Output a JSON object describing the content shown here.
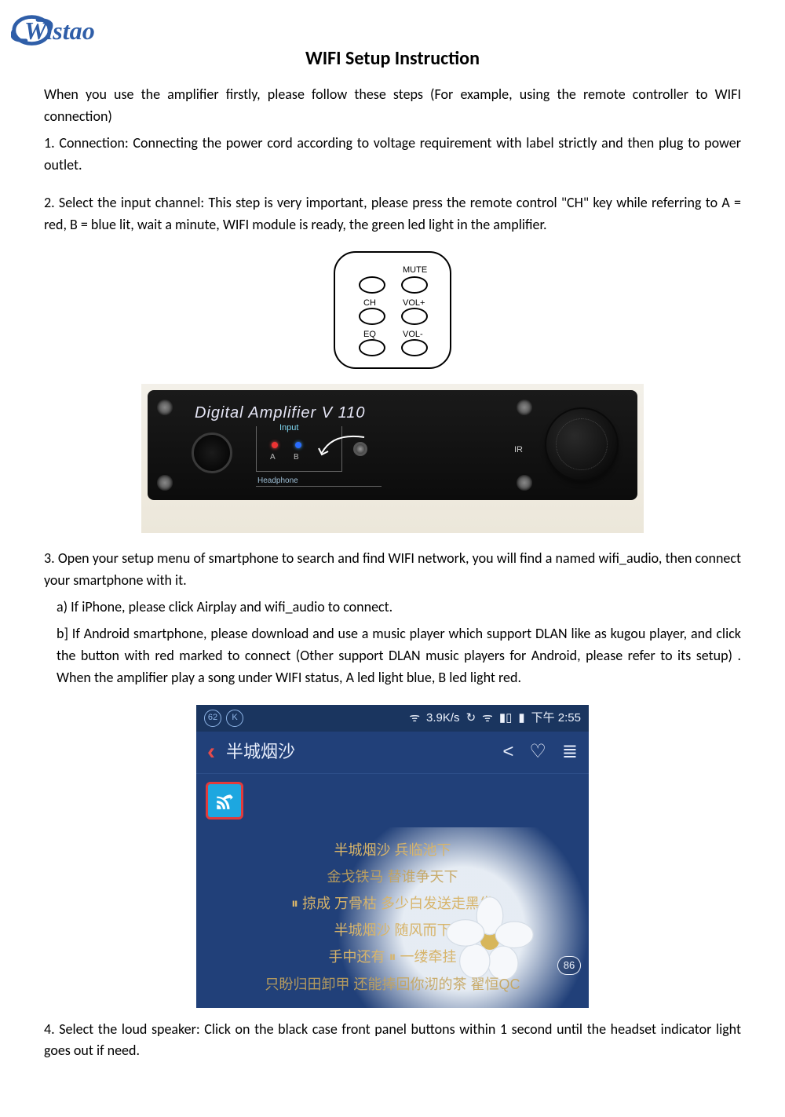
{
  "logo_text": "Wistao",
  "title": "WIFI Setup Instruction",
  "intro": "When you use the amplifier firstly, please follow these steps (For example, using the remote controller to WIFI connection)",
  "steps": {
    "s1": "1.    Connection: Connecting the power cord according to voltage requirement with label strictly and then plug to power outlet.",
    "s2": "2.    Select the input channel: This step is very important, please press the remote control \"CH\" key while referring to A = red, B = blue lit, wait a minute, WIFI module is ready, the green led light in the amplifier.",
    "s3": "3.    Open your setup menu of smartphone to search and find WIFI network, you will find a named wifi_audio, then connect your smartphone with it.",
    "s3a": "a) If iPhone, please click Airplay and wifi_audio to connect.",
    "s3b": "b] If Android smartphone, please download and use a music player which support DLAN like as kugou player, and click the button with red marked to connect (Other support DLAN music players for Android, please refer to its setup) . When the amplifier play a song under WIFI status, A led light blue, B led light red.",
    "s4": "4.    Select the loud speaker: Click on the black case front panel buttons within 1 second until the headset indicator light goes out if need."
  },
  "remote": {
    "mute": "MUTE",
    "ch": "CH",
    "volp": "VOL+",
    "eq": "EQ",
    "volm": "VOL-"
  },
  "amp": {
    "title": "Digital Amplifier V 110",
    "input": "Input",
    "a": "A",
    "b": "B",
    "headphone": "Headphone",
    "ir": "IR"
  },
  "phone": {
    "status": {
      "num": "62",
      "k": "K",
      "rate": "3.9K/s",
      "time": "下午 2:55"
    },
    "header": {
      "song_title": "半城烟沙"
    },
    "lyrics": {
      "l1": "半城烟沙 兵临池下",
      "l2": "金戈铁马 替谁争天下",
      "l3": "⏸ 掠成 万骨枯 多少白发送走黑发",
      "l4": "半城烟沙 随风而下",
      "l5": "手中还有 ⏸ 一缕牵挂",
      "l6": "只盼归田卸甲 还能捧回你沏的茶  翟恒QC",
      "badge": "86"
    }
  }
}
